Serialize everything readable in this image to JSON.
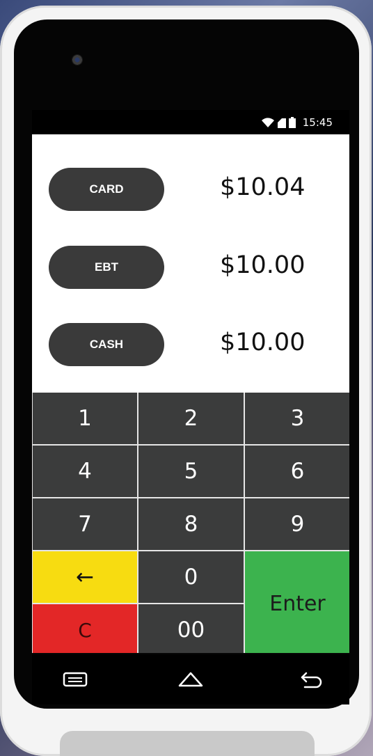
{
  "status_bar": {
    "time": "15:45",
    "icons": [
      "wifi-icon",
      "signal-icon",
      "battery-icon"
    ]
  },
  "payments": [
    {
      "method": "CARD",
      "amount": "$10.04"
    },
    {
      "method": "EBT",
      "amount": "$10.00"
    },
    {
      "method": "CASH",
      "amount": "$10.00"
    }
  ],
  "keypad": {
    "keys": [
      "1",
      "2",
      "3",
      "4",
      "5",
      "6",
      "7",
      "8",
      "9"
    ],
    "backspace": "←",
    "zero": "0",
    "enter": "Enter",
    "clear": "C",
    "double_zero": "00"
  },
  "nav_bar": {
    "icons": [
      "menu-icon",
      "home-icon",
      "back-icon"
    ]
  },
  "colors": {
    "backspace": "#f7dc11",
    "clear": "#e32727",
    "enter": "#3cb34e",
    "key": "#3b3c3c",
    "pay_button": "#3a3a3a"
  }
}
